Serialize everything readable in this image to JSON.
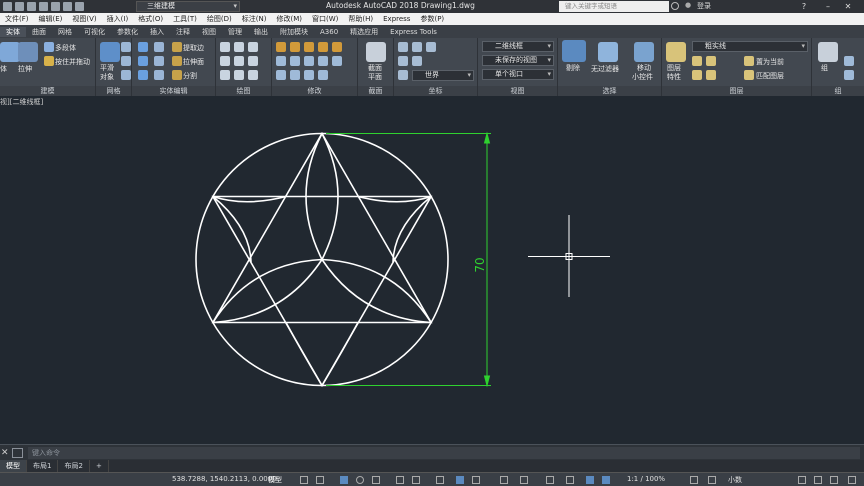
{
  "titlebar": {
    "workspace": "三维建模",
    "title": "Autodesk AutoCAD 2018    Drawing1.dwg",
    "search_placeholder": "键入关键字或短语",
    "signin": "登录"
  },
  "menu": [
    "文件(F)",
    "编辑(E)",
    "视图(V)",
    "插入(I)",
    "格式(O)",
    "工具(T)",
    "绘图(D)",
    "标注(N)",
    "修改(M)",
    "窗口(W)",
    "帮助(H)",
    "Express",
    "参数(P)"
  ],
  "ribbon_tabs": [
    "实体",
    "曲面",
    "网格",
    "可视化",
    "参数化",
    "插入",
    "注释",
    "视图",
    "管理",
    "输出",
    "附加模块",
    "A360",
    "精选应用",
    "Express Tools"
  ],
  "ribbon": {
    "panels": [
      "建模",
      "网格",
      "实体编辑",
      "绘图",
      "修改",
      "截面",
      "坐标",
      "视图",
      "选择",
      "图层",
      "组"
    ],
    "modeling": {
      "extrude": "拉伸",
      "box": "体",
      "polysolid": "多段体",
      "presspull": "按住并拖动"
    },
    "mesh": {
      "smooth_l1": "平滑",
      "smooth_l2": "对象"
    },
    "solidedit": {
      "extract": "提取边",
      "extrude_face": "拉伸面",
      "split": "分割"
    },
    "section": {
      "l1": "截面",
      "l2": "平面"
    },
    "view": {
      "visual_style": "二维线框",
      "unsaved_view": "未保存的视图",
      "ucs": "世界",
      "single_viewport": "单个视口"
    },
    "selection": {
      "cull": "剔除",
      "no_filter": "无过滤器",
      "gizmo_l1": "移动",
      "gizmo_l2": "小控件"
    },
    "layers": {
      "props_l1": "图层",
      "props_l2": "特性",
      "linetype": "粗实线",
      "set_current": "置为当前",
      "match_layer": "匹配图层"
    },
    "groups": {
      "group": "组"
    }
  },
  "viewport": {
    "label": "视][二维线框]"
  },
  "drawing": {
    "dimension_text": "70"
  },
  "command": {
    "placeholder": "键入命令"
  },
  "layout_tabs": [
    "模型",
    "布局1",
    "布局2"
  ],
  "status": {
    "coords": "538.7288, 1540.2113, 0.0000",
    "model": "模型",
    "scale": "1:1 / 100%",
    "units": "小数"
  },
  "colors": {
    "dimension": "#2fd12f",
    "geometry": "#ffffff",
    "background": "#212830"
  }
}
